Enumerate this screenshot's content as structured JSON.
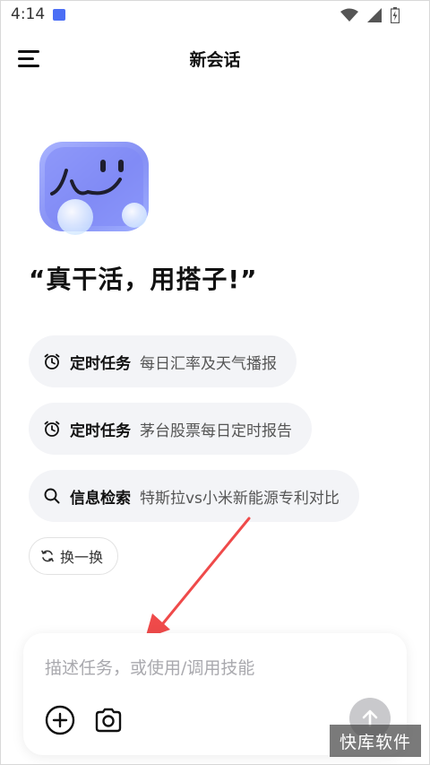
{
  "status_bar": {
    "time": "4:14"
  },
  "header": {
    "title": "新会话",
    "menu_icon": "hamburger-menu-icon"
  },
  "hero": {
    "mascot_icon": "smiling-ghost-mascot",
    "slogan": "“真干活，用搭子!”"
  },
  "suggestions": [
    {
      "icon": "alarm-clock-icon",
      "category": "定时任务",
      "text": "每日汇率及天气播报"
    },
    {
      "icon": "alarm-clock-icon",
      "category": "定时任务",
      "text": "茅台股票每日定时报告"
    },
    {
      "icon": "search-icon",
      "category": "信息检索",
      "text": "特斯拉vs小米新能源专利对比"
    }
  ],
  "refresh": {
    "label": "换一换",
    "icon": "refresh-icon"
  },
  "composer": {
    "placeholder": "描述任务，或使用/调用技能",
    "add_icon": "plus-circle-icon",
    "camera_icon": "camera-icon",
    "send_icon": "arrow-up-icon"
  },
  "watermark": "快库软件",
  "colors": {
    "accent": "#4b6ef5",
    "chip_bg": "#f3f4f7",
    "annotation_arrow": "#ef4a4a",
    "send_disabled": "#c9c9cc"
  }
}
